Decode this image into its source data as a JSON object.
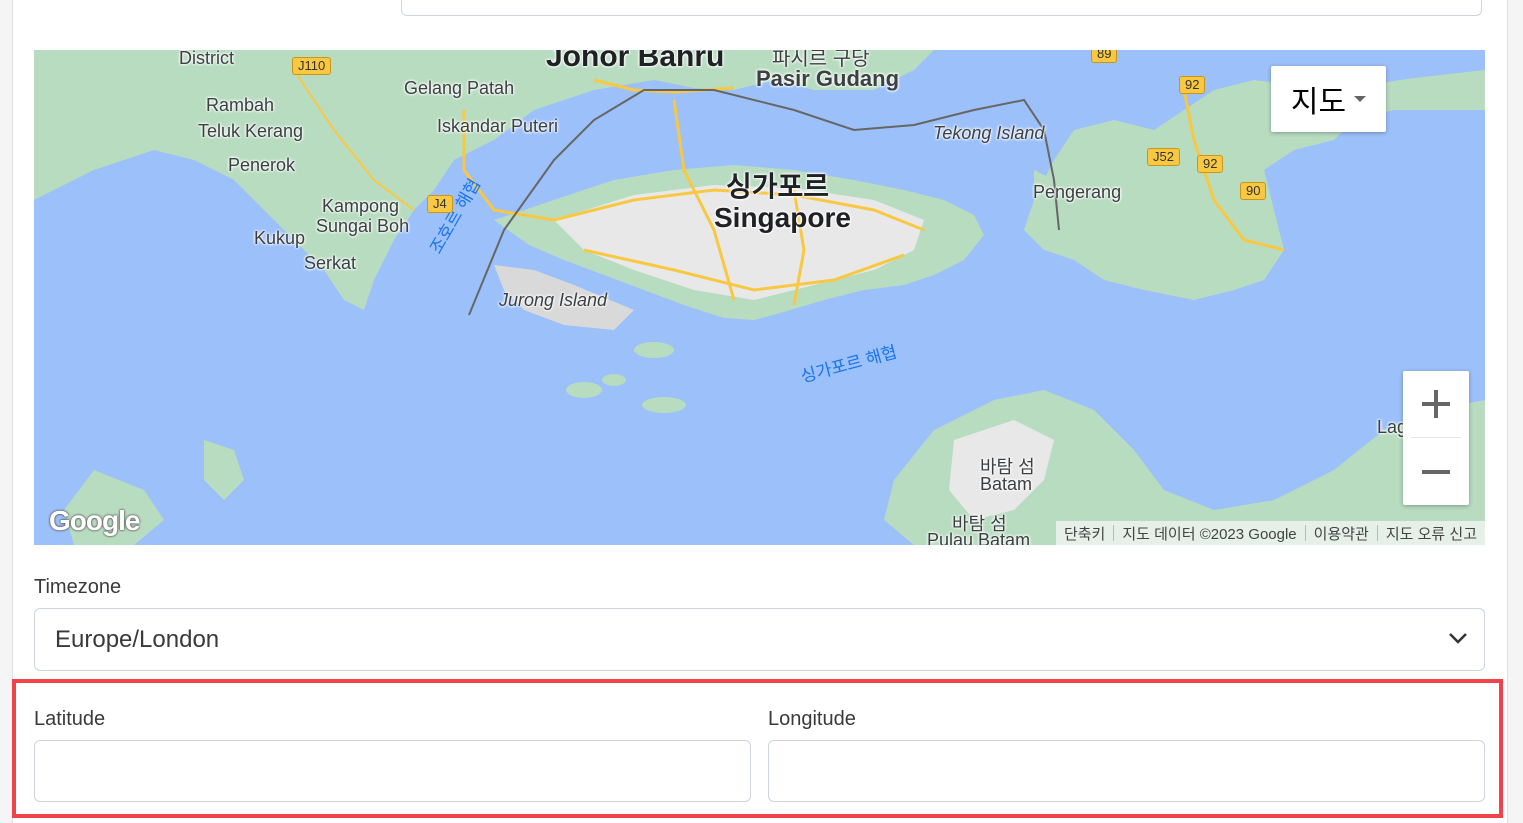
{
  "top_field": {
    "value": ""
  },
  "map": {
    "type_selector": "지도",
    "places": {
      "johor_bahru": "Johor Bahru",
      "pasir_gudang_ko": "파시르 구당",
      "pasir_gudang": "Pasir Gudang",
      "district": "District",
      "gelang_patah": "Gelang Patah",
      "rambah": "Rambah",
      "teluk_kerang": "Teluk Kerang",
      "iskandar_puteri": "Iskandar Puteri",
      "tekong_island": "Tekong Island",
      "penerok": "Penerok",
      "singapore_ko": "싱가포르",
      "singapore": "Singapore",
      "pengerang": "Pengerang",
      "kampong_sungai_boh_1": "Kampong",
      "kampong_sungai_boh_2": "Sungai Boh",
      "kukup": "Kukup",
      "serkat": "Serkat",
      "johor_strait": "조호르 해협",
      "jurong_island": "Jurong Island",
      "singapore_strait": "싱가포르 해협",
      "batam_ko": "바탐 섬",
      "batam": "Batam",
      "batam_ko_2": "바탐 섬",
      "pulau_batam": "Pulau Batam",
      "lag": "Lag"
    },
    "road_shields": [
      "J110",
      "J4",
      "89",
      "92",
      "J52",
      "92",
      "90"
    ],
    "icons": {
      "zoom_in": "plus-icon",
      "zoom_out": "minus-icon",
      "logo": "google-logo"
    },
    "logo_text": "Google",
    "attribution": {
      "shortcuts": "단축키",
      "data": "지도 데이터 ©2023 Google",
      "terms": "이용약관",
      "report": "지도 오류 신고"
    }
  },
  "timezone": {
    "label": "Timezone",
    "selected": "Europe/London"
  },
  "latitude": {
    "label": "Latitude",
    "value": ""
  },
  "longitude": {
    "label": "Longitude",
    "value": ""
  },
  "colors": {
    "highlight": "#f0434b",
    "water": "#9cc0f9",
    "land": "#b8dcc0",
    "roads": "#f9c842"
  }
}
